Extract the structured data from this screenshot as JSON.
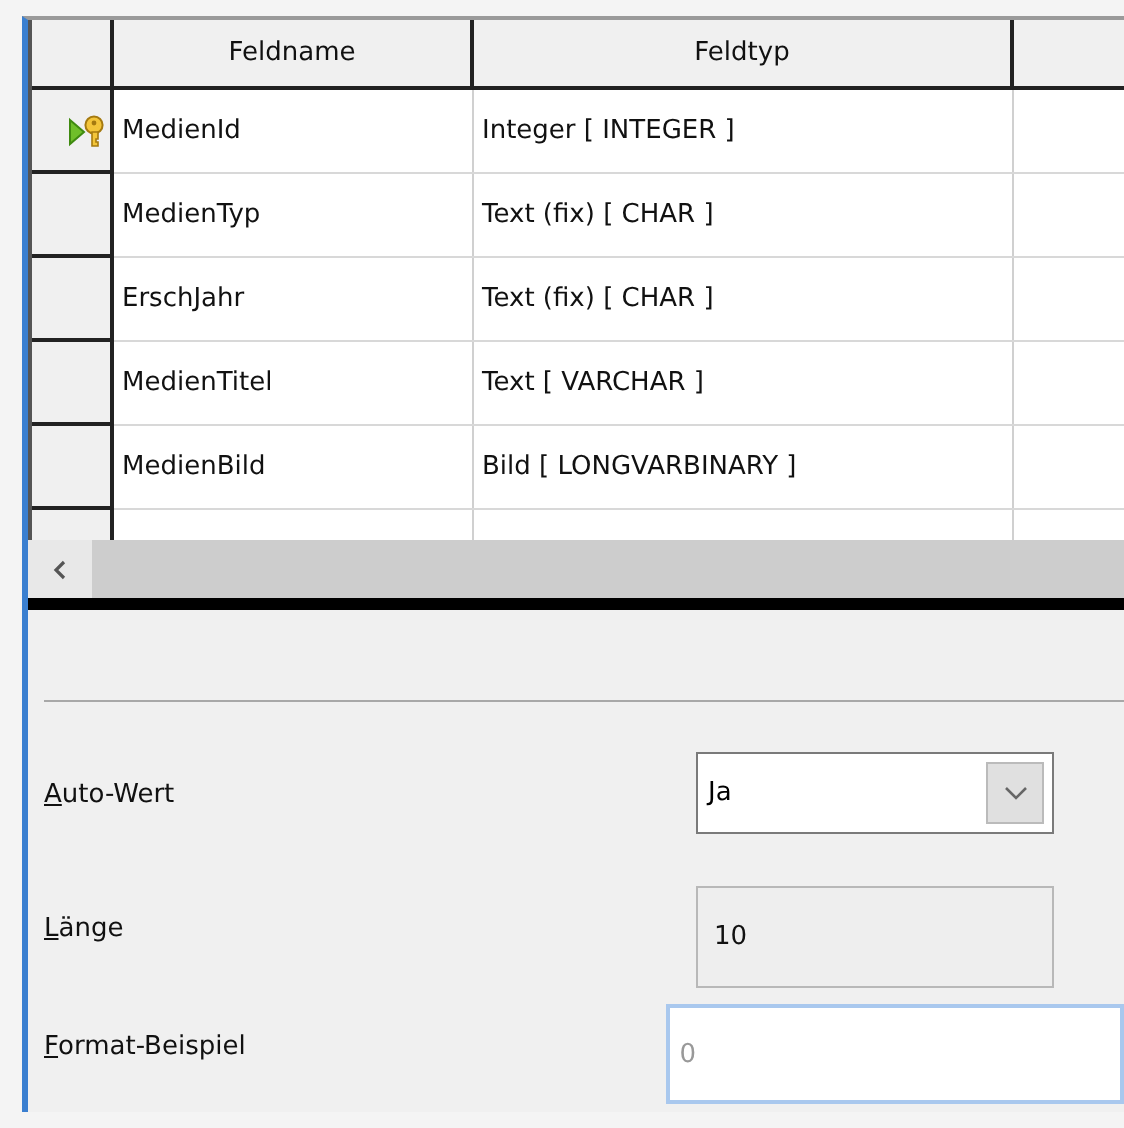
{
  "table": {
    "columns": [
      "Feldname",
      "Feldtyp"
    ],
    "rows": [
      {
        "name": "MedienId",
        "type": "Integer [ INTEGER ]",
        "primary_key": true
      },
      {
        "name": "MedienTyp",
        "type": "Text (fix) [ CHAR ]",
        "primary_key": false
      },
      {
        "name": "ErschJahr",
        "type": "Text (fix) [ CHAR ]",
        "primary_key": false
      },
      {
        "name": "MedienTitel",
        "type": "Text [ VARCHAR ]",
        "primary_key": false
      },
      {
        "name": "MedienBild",
        "type": "Bild [ LONGVARBINARY ]",
        "primary_key": false
      }
    ]
  },
  "properties": [
    {
      "kind": "dropdown",
      "label": "Auto-Wert",
      "value": "Ja"
    },
    {
      "kind": "readonly",
      "label": "Länge",
      "value": "10"
    },
    {
      "kind": "input",
      "label": "Format-Beispiel",
      "placeholder": "0"
    }
  ]
}
